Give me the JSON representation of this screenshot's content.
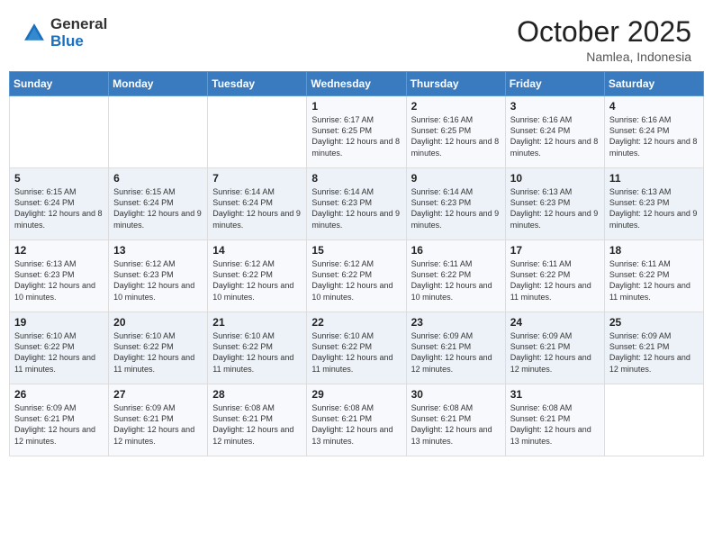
{
  "header": {
    "logo_general": "General",
    "logo_blue": "Blue",
    "month_title": "October 2025",
    "location": "Namlea, Indonesia"
  },
  "weekdays": [
    "Sunday",
    "Monday",
    "Tuesday",
    "Wednesday",
    "Thursday",
    "Friday",
    "Saturday"
  ],
  "weeks": [
    [
      {
        "day": "",
        "sunrise": "",
        "sunset": "",
        "daylight": ""
      },
      {
        "day": "",
        "sunrise": "",
        "sunset": "",
        "daylight": ""
      },
      {
        "day": "",
        "sunrise": "",
        "sunset": "",
        "daylight": ""
      },
      {
        "day": "1",
        "sunrise": "Sunrise: 6:17 AM",
        "sunset": "Sunset: 6:25 PM",
        "daylight": "Daylight: 12 hours and 8 minutes."
      },
      {
        "day": "2",
        "sunrise": "Sunrise: 6:16 AM",
        "sunset": "Sunset: 6:25 PM",
        "daylight": "Daylight: 12 hours and 8 minutes."
      },
      {
        "day": "3",
        "sunrise": "Sunrise: 6:16 AM",
        "sunset": "Sunset: 6:24 PM",
        "daylight": "Daylight: 12 hours and 8 minutes."
      },
      {
        "day": "4",
        "sunrise": "Sunrise: 6:16 AM",
        "sunset": "Sunset: 6:24 PM",
        "daylight": "Daylight: 12 hours and 8 minutes."
      }
    ],
    [
      {
        "day": "5",
        "sunrise": "Sunrise: 6:15 AM",
        "sunset": "Sunset: 6:24 PM",
        "daylight": "Daylight: 12 hours and 8 minutes."
      },
      {
        "day": "6",
        "sunrise": "Sunrise: 6:15 AM",
        "sunset": "Sunset: 6:24 PM",
        "daylight": "Daylight: 12 hours and 9 minutes."
      },
      {
        "day": "7",
        "sunrise": "Sunrise: 6:14 AM",
        "sunset": "Sunset: 6:24 PM",
        "daylight": "Daylight: 12 hours and 9 minutes."
      },
      {
        "day": "8",
        "sunrise": "Sunrise: 6:14 AM",
        "sunset": "Sunset: 6:23 PM",
        "daylight": "Daylight: 12 hours and 9 minutes."
      },
      {
        "day": "9",
        "sunrise": "Sunrise: 6:14 AM",
        "sunset": "Sunset: 6:23 PM",
        "daylight": "Daylight: 12 hours and 9 minutes."
      },
      {
        "day": "10",
        "sunrise": "Sunrise: 6:13 AM",
        "sunset": "Sunset: 6:23 PM",
        "daylight": "Daylight: 12 hours and 9 minutes."
      },
      {
        "day": "11",
        "sunrise": "Sunrise: 6:13 AM",
        "sunset": "Sunset: 6:23 PM",
        "daylight": "Daylight: 12 hours and 9 minutes."
      }
    ],
    [
      {
        "day": "12",
        "sunrise": "Sunrise: 6:13 AM",
        "sunset": "Sunset: 6:23 PM",
        "daylight": "Daylight: 12 hours and 10 minutes."
      },
      {
        "day": "13",
        "sunrise": "Sunrise: 6:12 AM",
        "sunset": "Sunset: 6:23 PM",
        "daylight": "Daylight: 12 hours and 10 minutes."
      },
      {
        "day": "14",
        "sunrise": "Sunrise: 6:12 AM",
        "sunset": "Sunset: 6:22 PM",
        "daylight": "Daylight: 12 hours and 10 minutes."
      },
      {
        "day": "15",
        "sunrise": "Sunrise: 6:12 AM",
        "sunset": "Sunset: 6:22 PM",
        "daylight": "Daylight: 12 hours and 10 minutes."
      },
      {
        "day": "16",
        "sunrise": "Sunrise: 6:11 AM",
        "sunset": "Sunset: 6:22 PM",
        "daylight": "Daylight: 12 hours and 10 minutes."
      },
      {
        "day": "17",
        "sunrise": "Sunrise: 6:11 AM",
        "sunset": "Sunset: 6:22 PM",
        "daylight": "Daylight: 12 hours and 11 minutes."
      },
      {
        "day": "18",
        "sunrise": "Sunrise: 6:11 AM",
        "sunset": "Sunset: 6:22 PM",
        "daylight": "Daylight: 12 hours and 11 minutes."
      }
    ],
    [
      {
        "day": "19",
        "sunrise": "Sunrise: 6:10 AM",
        "sunset": "Sunset: 6:22 PM",
        "daylight": "Daylight: 12 hours and 11 minutes."
      },
      {
        "day": "20",
        "sunrise": "Sunrise: 6:10 AM",
        "sunset": "Sunset: 6:22 PM",
        "daylight": "Daylight: 12 hours and 11 minutes."
      },
      {
        "day": "21",
        "sunrise": "Sunrise: 6:10 AM",
        "sunset": "Sunset: 6:22 PM",
        "daylight": "Daylight: 12 hours and 11 minutes."
      },
      {
        "day": "22",
        "sunrise": "Sunrise: 6:10 AM",
        "sunset": "Sunset: 6:22 PM",
        "daylight": "Daylight: 12 hours and 11 minutes."
      },
      {
        "day": "23",
        "sunrise": "Sunrise: 6:09 AM",
        "sunset": "Sunset: 6:21 PM",
        "daylight": "Daylight: 12 hours and 12 minutes."
      },
      {
        "day": "24",
        "sunrise": "Sunrise: 6:09 AM",
        "sunset": "Sunset: 6:21 PM",
        "daylight": "Daylight: 12 hours and 12 minutes."
      },
      {
        "day": "25",
        "sunrise": "Sunrise: 6:09 AM",
        "sunset": "Sunset: 6:21 PM",
        "daylight": "Daylight: 12 hours and 12 minutes."
      }
    ],
    [
      {
        "day": "26",
        "sunrise": "Sunrise: 6:09 AM",
        "sunset": "Sunset: 6:21 PM",
        "daylight": "Daylight: 12 hours and 12 minutes."
      },
      {
        "day": "27",
        "sunrise": "Sunrise: 6:09 AM",
        "sunset": "Sunset: 6:21 PM",
        "daylight": "Daylight: 12 hours and 12 minutes."
      },
      {
        "day": "28",
        "sunrise": "Sunrise: 6:08 AM",
        "sunset": "Sunset: 6:21 PM",
        "daylight": "Daylight: 12 hours and 12 minutes."
      },
      {
        "day": "29",
        "sunrise": "Sunrise: 6:08 AM",
        "sunset": "Sunset: 6:21 PM",
        "daylight": "Daylight: 12 hours and 13 minutes."
      },
      {
        "day": "30",
        "sunrise": "Sunrise: 6:08 AM",
        "sunset": "Sunset: 6:21 PM",
        "daylight": "Daylight: 12 hours and 13 minutes."
      },
      {
        "day": "31",
        "sunrise": "Sunrise: 6:08 AM",
        "sunset": "Sunset: 6:21 PM",
        "daylight": "Daylight: 12 hours and 13 minutes."
      },
      {
        "day": "",
        "sunrise": "",
        "sunset": "",
        "daylight": ""
      }
    ]
  ]
}
